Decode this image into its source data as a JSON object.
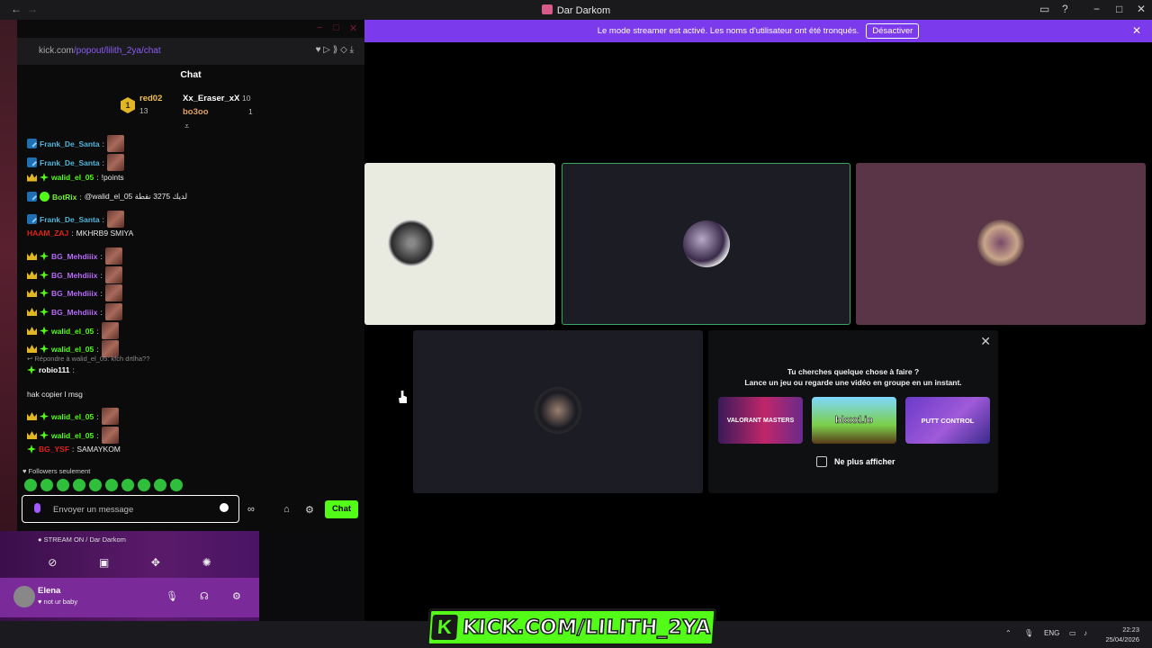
{
  "window": {
    "title": "Dar Darkom"
  },
  "banner": {
    "text": "Le mode streamer est activé. Les noms d'utilisateur ont été tronqués.",
    "button": "Désactiver"
  },
  "tiles": [
    {
      "bg": "#e9eae0",
      "border": "none"
    },
    {
      "bg": "#1b1c24",
      "border": "#3ba55d"
    },
    {
      "bg": "#5a3548",
      "border": "none"
    },
    {
      "bg": "#1b1c24",
      "border": "none"
    }
  ],
  "suggest": {
    "line1": "Tu cherches quelque chose à faire ?",
    "line2": "Lance un jeu ou regarde une vidéo en groupe en un instant.",
    "games": [
      "VALORANT MASTERS",
      "bloxd.io",
      "PUTT CONTROL"
    ],
    "checkbox": "Ne plus afficher"
  },
  "kick": {
    "url_host": "kick.com",
    "url_path": "/popout/lilith_2ya/chat",
    "header": "Chat",
    "leaderboard": {
      "first": {
        "rank": "1",
        "name": "red02",
        "count": "13"
      },
      "second": {
        "name": "Xx_Eraser_xX",
        "count": "10"
      },
      "third": {
        "name": "bo3oo",
        "count": "1"
      }
    },
    "messages": [
      {
        "user": "Frank_De_Santa",
        "color": "n-blue",
        "badges": [
          "mod"
        ],
        "text": "",
        "emote": true
      },
      {
        "user": "Frank_De_Santa",
        "color": "n-blue",
        "badges": [
          "mod"
        ],
        "text": "",
        "emote": true
      },
      {
        "user": "walid_el_05",
        "color": "n-green",
        "badges": [
          "crown",
          "spark"
        ],
        "text": "!points",
        "emote": false
      },
      {
        "user": "BotRix",
        "color": "n-lime",
        "badges": [
          "mod",
          "verif"
        ],
        "text": "@walid_el_05 لديك 3275 نقطة",
        "emote": false
      },
      {
        "user": "Frank_De_Santa",
        "color": "n-blue",
        "badges": [
          "mod"
        ],
        "text": "",
        "emote": true
      },
      {
        "user": "HAAM_ZAJ",
        "color": "n-red",
        "badges": [],
        "text": "MKHRB9 SMIYA",
        "emote": false
      },
      {
        "user": "BG_Mehdiiix",
        "color": "n-purple",
        "badges": [
          "crown",
          "spark"
        ],
        "text": "",
        "emote": true
      },
      {
        "user": "BG_Mehdiiix",
        "color": "n-purple",
        "badges": [
          "crown",
          "spark"
        ],
        "text": "",
        "emote": true
      },
      {
        "user": "BG_Mehdiiix",
        "color": "n-purple",
        "badges": [
          "crown",
          "spark"
        ],
        "text": "",
        "emote": true
      },
      {
        "user": "BG_Mehdiiix",
        "color": "n-purple",
        "badges": [
          "crown",
          "spark"
        ],
        "text": "",
        "emote": true
      },
      {
        "user": "walid_el_05",
        "color": "n-green",
        "badges": [
          "crown",
          "spark"
        ],
        "text": "",
        "emote": true
      },
      {
        "user": "walid_el_05",
        "color": "n-green",
        "badges": [
          "crown",
          "spark"
        ],
        "text": "",
        "emote": true
      }
    ],
    "reply": "Répondre à walid_el_05: kfch drtlha??",
    "reply_user": "robio111",
    "reply_text": "hak copier l msg",
    "messages2": [
      {
        "user": "walid_el_05",
        "color": "n-green",
        "badges": [
          "crown",
          "spark"
        ],
        "text": "",
        "emote": true
      },
      {
        "user": "walid_el_05",
        "color": "n-green",
        "badges": [
          "crown",
          "spark"
        ],
        "text": "",
        "emote": true
      },
      {
        "user": "BG_YSF",
        "color": "n-red",
        "badges": [
          "spark"
        ],
        "text": "SAMAYKOM",
        "emote": false
      }
    ],
    "followers": "Followers seulement",
    "input_placeholder": "Envoyer un message",
    "chat_button": "Chat"
  },
  "sidebar": {
    "voice_status": "STREAM ON / Dar Darkom",
    "user_name": "Elena",
    "user_status": "not ur baby"
  },
  "taskbar": {
    "lang": "ENG",
    "time": "22:23",
    "date": "25/04/2026"
  },
  "overlay": {
    "text": "KICK.COM/LILITH_2YA",
    "k": "K"
  }
}
